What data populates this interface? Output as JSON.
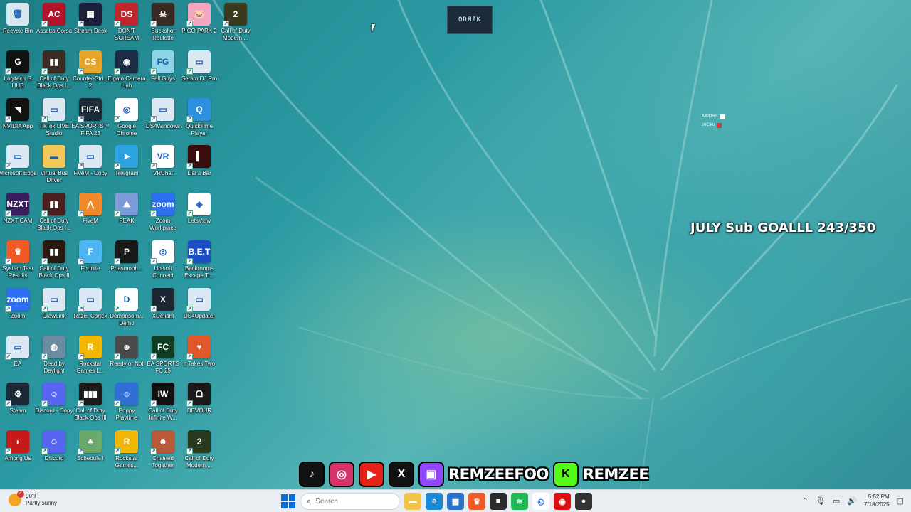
{
  "desktop": {
    "icons": [
      {
        "label": "Recycle Bin",
        "icon": "recycle-bin-icon",
        "bg": "#d8e6f0",
        "glyph": "🗑",
        "col": 0,
        "row": 0,
        "shortcut": false
      },
      {
        "label": "Assetto Corsa",
        "icon": "assetto-corsa-icon",
        "bg": "#b3122b",
        "glyph": "AC",
        "col": 1,
        "row": 0,
        "shortcut": true
      },
      {
        "label": "Stream Deck",
        "icon": "stream-deck-icon",
        "bg": "#1b1f3a",
        "glyph": "▦",
        "col": 2,
        "row": 0,
        "shortcut": true
      },
      {
        "label": "DON'T SCREAM",
        "icon": "dont-scream-icon",
        "bg": "#c0262d",
        "glyph": "DS",
        "col": 3,
        "row": 0,
        "shortcut": true
      },
      {
        "label": "Buckshot Roulette",
        "icon": "buckshot-roulette-icon",
        "bg": "#3a2a24",
        "glyph": "☠",
        "col": 4,
        "row": 0,
        "shortcut": true
      },
      {
        "label": "PICO PARK 2",
        "icon": "pico-park-icon",
        "bg": "#f1a7c0",
        "glyph": "🐷",
        "col": 5,
        "row": 0,
        "shortcut": true
      },
      {
        "label": "Call of Duty Modern ...",
        "icon": "call-of-duty-icon",
        "bg": "#3b3a1e",
        "glyph": "2",
        "col": 6,
        "row": 0,
        "shortcut": true
      },
      {
        "label": "Logitech G HUB",
        "icon": "logitech-g-hub-icon",
        "bg": "#111111",
        "glyph": "G",
        "col": 0,
        "row": 1,
        "shortcut": true
      },
      {
        "label": "Call of Duty Black Ops I...",
        "icon": "call-of-duty-icon",
        "bg": "#3c2b22",
        "glyph": "▮▮",
        "col": 1,
        "row": 1,
        "shortcut": true
      },
      {
        "label": "Counter-Stri... 2",
        "icon": "counter-strike-icon",
        "bg": "#e7a42a",
        "glyph": "CS",
        "col": 2,
        "row": 1,
        "shortcut": true
      },
      {
        "label": "Elgato Camera Hub",
        "icon": "elgato-camera-hub-icon",
        "bg": "#1e2b44",
        "glyph": "◉",
        "col": 3,
        "row": 1,
        "shortcut": true
      },
      {
        "label": "Fall Guys",
        "icon": "fall-guys-icon",
        "bg": "#8fd3e8",
        "glyph": "FG",
        "col": 4,
        "row": 1,
        "shortcut": true
      },
      {
        "label": "Serato DJ Pro",
        "icon": "serato-dj-pro-icon",
        "bg": "#dce8f3",
        "glyph": "▭",
        "col": 5,
        "row": 1,
        "shortcut": true
      },
      {
        "label": "NVIDIA App",
        "icon": "nvidia-app-icon",
        "bg": "#111111",
        "glyph": "◥",
        "col": 0,
        "row": 2,
        "shortcut": true
      },
      {
        "label": "TikTok LIVE Studio",
        "icon": "tiktok-live-studio-icon",
        "bg": "#dce8f3",
        "glyph": "▭",
        "col": 1,
        "row": 2,
        "shortcut": true
      },
      {
        "label": "EA SPORTS™ FIFA 23",
        "icon": "fifa-23-icon",
        "bg": "#1d2c3a",
        "glyph": "FIFA",
        "col": 2,
        "row": 2,
        "shortcut": true
      },
      {
        "label": "Google Chrome",
        "icon": "chrome-icon",
        "bg": "#ffffff",
        "glyph": "◎",
        "col": 3,
        "row": 2,
        "shortcut": true
      },
      {
        "label": "DS4Windows",
        "icon": "ds4windows-icon",
        "bg": "#dce8f3",
        "glyph": "▭",
        "col": 4,
        "row": 2,
        "shortcut": true
      },
      {
        "label": "QuickTime Player",
        "icon": "quicktime-player-icon",
        "bg": "#2d8fe0",
        "glyph": "Q",
        "col": 5,
        "row": 2,
        "shortcut": true
      },
      {
        "label": "Microsoft Edge",
        "icon": "edge-icon",
        "bg": "#dce8f3",
        "glyph": "▭",
        "col": 0,
        "row": 3,
        "shortcut": true
      },
      {
        "label": "Virtual Bus Driver",
        "icon": "folder-icon",
        "bg": "#f1c75a",
        "glyph": "▬",
        "col": 1,
        "row": 3,
        "shortcut": false
      },
      {
        "label": "FiveM - Copy",
        "icon": "fivem-icon",
        "bg": "#dce8f3",
        "glyph": "▭",
        "col": 2,
        "row": 3,
        "shortcut": true
      },
      {
        "label": "Telegram",
        "icon": "telegram-icon",
        "bg": "#2aa3e0",
        "glyph": "➤",
        "col": 3,
        "row": 3,
        "shortcut": true
      },
      {
        "label": "VRChat",
        "icon": "vrchat-icon",
        "bg": "#ffffff",
        "glyph": "VR",
        "col": 4,
        "row": 3,
        "shortcut": true
      },
      {
        "label": "Liar's Bar",
        "icon": "liars-bar-icon",
        "bg": "#3a0d0d",
        "glyph": "▍",
        "col": 5,
        "row": 3,
        "shortcut": true
      },
      {
        "label": "NZXT CAM",
        "icon": "nzxt-cam-icon",
        "bg": "#3b1e5e",
        "glyph": "NZXT",
        "col": 0,
        "row": 4,
        "shortcut": true
      },
      {
        "label": "Call of Duty Black Ops I...",
        "icon": "call-of-duty-icon",
        "bg": "#4a1f1f",
        "glyph": "▮▮",
        "col": 1,
        "row": 4,
        "shortcut": true
      },
      {
        "label": "FiveM",
        "icon": "fivem-icon",
        "bg": "#f08a2a",
        "glyph": "⋀",
        "col": 2,
        "row": 4,
        "shortcut": true
      },
      {
        "label": "PEAK",
        "icon": "peak-icon",
        "bg": "#7d9bd8",
        "glyph": "⛰",
        "col": 3,
        "row": 4,
        "shortcut": true
      },
      {
        "label": "Zoom Workplace",
        "icon": "zoom-workplace-icon",
        "bg": "#2d6ff0",
        "glyph": "zoom",
        "col": 4,
        "row": 4,
        "shortcut": true
      },
      {
        "label": "LetsView",
        "icon": "letsview-icon",
        "bg": "#ffffff",
        "glyph": "◈",
        "col": 5,
        "row": 4,
        "shortcut": true
      },
      {
        "label": "System Test Results",
        "icon": "brave-icon",
        "bg": "#f15a24",
        "glyph": "♛",
        "col": 0,
        "row": 5,
        "shortcut": true
      },
      {
        "label": "Call of Duty Black Ops II",
        "icon": "call-of-duty-icon",
        "bg": "#2a1a12",
        "glyph": "▮▮",
        "col": 1,
        "row": 5,
        "shortcut": true
      },
      {
        "label": "Fortnite",
        "icon": "fortnite-icon",
        "bg": "#4db6f2",
        "glyph": "F",
        "col": 2,
        "row": 5,
        "shortcut": true
      },
      {
        "label": "Phasmoph...",
        "icon": "phasmophobia-icon",
        "bg": "#181818",
        "glyph": "P",
        "col": 3,
        "row": 5,
        "shortcut": true
      },
      {
        "label": "Ubisoft Connect",
        "icon": "ubisoft-connect-icon",
        "bg": "#ffffff",
        "glyph": "◎",
        "col": 4,
        "row": 5,
        "shortcut": true
      },
      {
        "label": "Backrooms Escape Ti...",
        "icon": "backrooms-icon",
        "bg": "#1d4fc4",
        "glyph": "B.E.T",
        "col": 5,
        "row": 5,
        "shortcut": true
      },
      {
        "label": "Zoom",
        "icon": "zoom-icon",
        "bg": "#2d6ff0",
        "glyph": "zoom",
        "col": 0,
        "row": 6,
        "shortcut": true
      },
      {
        "label": "CrewLink",
        "icon": "crewlink-icon",
        "bg": "#dce8f3",
        "glyph": "▭",
        "col": 1,
        "row": 6,
        "shortcut": true
      },
      {
        "label": "Razer Cortex",
        "icon": "razer-cortex-icon",
        "bg": "#dce8f3",
        "glyph": "▭",
        "col": 2,
        "row": 6,
        "shortcut": true
      },
      {
        "label": "Demonsom... Demo",
        "icon": "demonsom-icon",
        "bg": "#ffffff",
        "glyph": "D",
        "col": 3,
        "row": 6,
        "shortcut": true
      },
      {
        "label": "XDefiant",
        "icon": "xdefiant-icon",
        "bg": "#1d2532",
        "glyph": "X",
        "col": 4,
        "row": 6,
        "shortcut": true
      },
      {
        "label": "DS4Updater",
        "icon": "ds4updater-icon",
        "bg": "#dce8f3",
        "glyph": "▭",
        "col": 5,
        "row": 6,
        "shortcut": true
      },
      {
        "label": "EA",
        "icon": "ea-icon",
        "bg": "#dce8f3",
        "glyph": "▭",
        "col": 0,
        "row": 7,
        "shortcut": true
      },
      {
        "label": "Dead by Daylight",
        "icon": "dead-by-daylight-icon",
        "bg": "#6b8ba0",
        "glyph": "◍",
        "col": 1,
        "row": 7,
        "shortcut": true
      },
      {
        "label": "Rockstar Games L...",
        "icon": "rockstar-games-icon",
        "bg": "#f2b705",
        "glyph": "R",
        "col": 2,
        "row": 7,
        "shortcut": true
      },
      {
        "label": "Ready or Not",
        "icon": "ready-or-not-icon",
        "bg": "#4a4a4a",
        "glyph": "☻",
        "col": 3,
        "row": 7,
        "shortcut": true
      },
      {
        "label": "EA SPORTS FC 25",
        "icon": "ea-sports-fc-icon",
        "bg": "#0f3d24",
        "glyph": "FC",
        "col": 4,
        "row": 7,
        "shortcut": true
      },
      {
        "label": "It Takes Two",
        "icon": "it-takes-two-icon",
        "bg": "#e0582a",
        "glyph": "♥",
        "col": 5,
        "row": 7,
        "shortcut": true
      },
      {
        "label": "Steam",
        "icon": "steam-icon",
        "bg": "#1b2838",
        "glyph": "⚙",
        "col": 0,
        "row": 8,
        "shortcut": true
      },
      {
        "label": "Discord - Copy",
        "icon": "discord-icon",
        "bg": "#5865f2",
        "glyph": "☺",
        "col": 1,
        "row": 8,
        "shortcut": true
      },
      {
        "label": "Call of Duty Black Ops III",
        "icon": "call-of-duty-icon",
        "bg": "#1a1a1a",
        "glyph": "▮▮▮",
        "col": 2,
        "row": 8,
        "shortcut": true
      },
      {
        "label": "Poppy Playtime",
        "icon": "poppy-playtime-icon",
        "bg": "#2f6fd6",
        "glyph": "☺",
        "col": 3,
        "row": 8,
        "shortcut": true
      },
      {
        "label": "Call of Duty Infinite W...",
        "icon": "call-of-duty-icon",
        "bg": "#111111",
        "glyph": "IW",
        "col": 4,
        "row": 8,
        "shortcut": true
      },
      {
        "label": "DEVOUR",
        "icon": "devour-icon",
        "bg": "#1a1a1a",
        "glyph": "ᗝ",
        "col": 5,
        "row": 8,
        "shortcut": true
      },
      {
        "label": "Among Us",
        "icon": "among-us-icon",
        "bg": "#c61a1a",
        "glyph": "◗",
        "col": 0,
        "row": 9,
        "shortcut": true
      },
      {
        "label": "Discord",
        "icon": "discord-icon",
        "bg": "#5865f2",
        "glyph": "☺",
        "col": 1,
        "row": 9,
        "shortcut": true
      },
      {
        "label": "Schedule I",
        "icon": "schedule-i-icon",
        "bg": "#6aa86a",
        "glyph": "♣",
        "col": 2,
        "row": 9,
        "shortcut": true
      },
      {
        "label": "Rockstar Games...",
        "icon": "rockstar-games-icon",
        "bg": "#f2b705",
        "glyph": "R",
        "col": 3,
        "row": 9,
        "shortcut": true
      },
      {
        "label": "Chained Together",
        "icon": "chained-together-icon",
        "bg": "#b85a3a",
        "glyph": "☻",
        "col": 4,
        "row": 9,
        "shortcut": true
      },
      {
        "label": "Call of Duty Modern ...",
        "icon": "call-of-duty-icon",
        "bg": "#2a3a1e",
        "glyph": "2",
        "col": 5,
        "row": 9,
        "shortcut": true
      }
    ]
  },
  "overlay": {
    "kirdo_label": "ODЯIK",
    "mini_widget": [
      {
        "text": "AXIONS",
        "color": "#ffffff"
      },
      {
        "text": "lmCiko",
        "color": "#d33a2f"
      }
    ],
    "sub_goal": "JULY Sub GOALLL 243/350",
    "socials": [
      {
        "name": "tiktok-icon",
        "bg": "#111111",
        "glyph": "♪"
      },
      {
        "name": "instagram-icon",
        "bg": "#d6336c",
        "glyph": "◎"
      },
      {
        "name": "youtube-icon",
        "bg": "#e62117",
        "glyph": "▶"
      },
      {
        "name": "x-icon",
        "bg": "#111111",
        "glyph": "X"
      },
      {
        "name": "twitch-icon",
        "bg": "#9146ff",
        "glyph": "▣"
      }
    ],
    "handle_primary": "REMZEEFOO",
    "kick_icon": {
      "bg": "#53fc18",
      "glyph": "K"
    },
    "handle_secondary": "REMZEE"
  },
  "taskbar": {
    "weather": {
      "temp": "90°F",
      "condition": "Partly sunny",
      "badge": "4"
    },
    "search_placeholder": "Search",
    "apps": [
      {
        "name": "file-explorer-icon",
        "bg": "#f3c449",
        "glyph": "▬"
      },
      {
        "name": "edge-icon",
        "bg": "#1a8ad8",
        "glyph": "e"
      },
      {
        "name": "store-icon",
        "bg": "#2a72c8",
        "glyph": "▦"
      },
      {
        "name": "brave-icon",
        "bg": "#f15a24",
        "glyph": "♛"
      },
      {
        "name": "app-icon",
        "bg": "#2b2b2b",
        "glyph": "■"
      },
      {
        "name": "spotify-icon",
        "bg": "#1db954",
        "glyph": "≋"
      },
      {
        "name": "chrome-icon",
        "bg": "#ffffff",
        "glyph": "◎"
      },
      {
        "name": "razer-icon",
        "bg": "#d11",
        "glyph": "◉"
      },
      {
        "name": "recording-icon",
        "bg": "#333333",
        "glyph": "●"
      }
    ],
    "clock": {
      "time": "5:52 PM",
      "date": "7/18/2025"
    }
  }
}
